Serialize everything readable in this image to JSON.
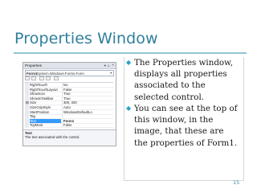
{
  "slide": {
    "title": "Properties Window",
    "page_number": "15",
    "accent_color": "#2f7f9c"
  },
  "properties_window": {
    "title": "Properties",
    "pin_icon": "pin-icon",
    "close_icon": "close-icon",
    "object_name": "Form1",
    "object_type": "System.Windows.Forms.Form",
    "rows": [
      {
        "name": "RightToLeft",
        "value": "No",
        "expandable": false,
        "selected": false
      },
      {
        "name": "RightToLeftLayout",
        "value": "False",
        "expandable": false,
        "selected": false
      },
      {
        "name": "ShowIcon",
        "value": "True",
        "expandable": false,
        "selected": false
      },
      {
        "name": "ShowInTaskbar",
        "value": "True",
        "expandable": false,
        "selected": false
      },
      {
        "name": "Size",
        "value": "300, 300",
        "expandable": true,
        "selected": false
      },
      {
        "name": "SizeGripStyle",
        "value": "Auto",
        "expandable": false,
        "selected": false
      },
      {
        "name": "StartPosition",
        "value": "WindowsDefaultLo",
        "expandable": false,
        "selected": false
      },
      {
        "name": "Tag",
        "value": "",
        "expandable": false,
        "selected": false
      },
      {
        "name": "Text",
        "value": "Form1",
        "expandable": false,
        "selected": true
      },
      {
        "name": "TopMost",
        "value": "False",
        "expandable": false,
        "selected": false
      }
    ],
    "description_title": "Text",
    "description_text": "The text associated with the control."
  },
  "bullets": [
    {
      "lines": [
        "The Properties window,",
        "displays all properties",
        "associated to the",
        "selected control."
      ]
    },
    {
      "lines": [
        "You can see at the top of",
        "this window, in the",
        "image, that these are",
        "the properties of Form1."
      ]
    }
  ]
}
